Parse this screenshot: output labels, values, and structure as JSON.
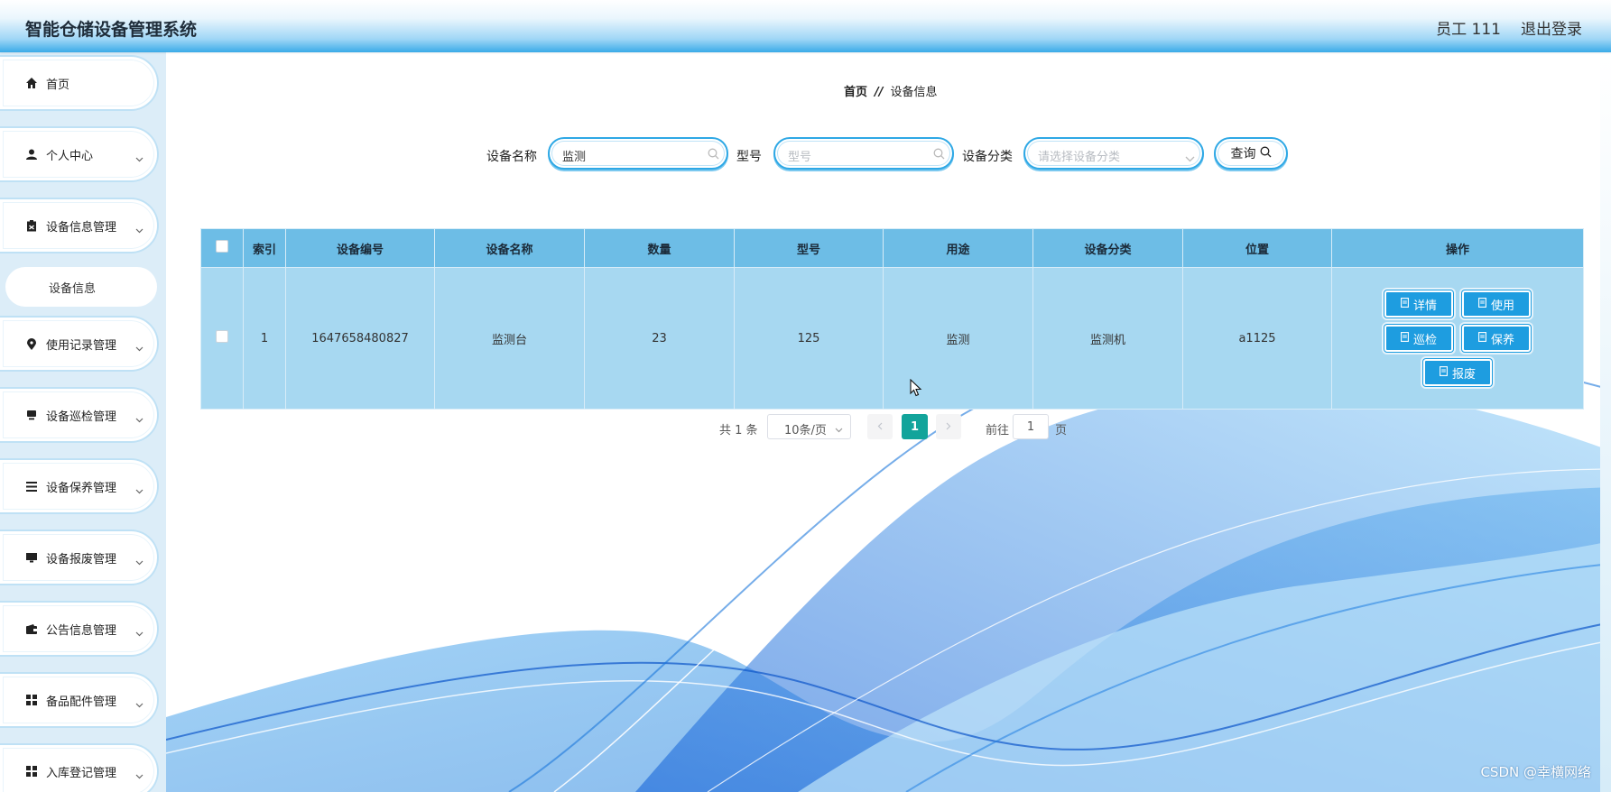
{
  "header": {
    "title": "智能仓储设备管理系统",
    "user": "员工 111",
    "logout": "退出登录"
  },
  "sidebar": {
    "items": [
      {
        "label": "首页",
        "icon": "home-icon"
      },
      {
        "label": "个人中心",
        "icon": "user-icon"
      },
      {
        "label": "设备信息管理",
        "icon": "clipboard-icon"
      },
      {
        "label": "使用记录管理",
        "icon": "location-pin-icon"
      },
      {
        "label": "设备巡检管理",
        "icon": "monitor-icon"
      },
      {
        "label": "设备保养管理",
        "icon": "list-icon"
      },
      {
        "label": "设备报废管理",
        "icon": "desktop-icon"
      },
      {
        "label": "公告信息管理",
        "icon": "wallet-icon"
      },
      {
        "label": "备品配件管理",
        "icon": "grid-icon"
      },
      {
        "label": "入库登记管理",
        "icon": "grid-icon"
      }
    ],
    "active_sub": "设备信息"
  },
  "breadcrumb": {
    "home": "首页",
    "separator": "//",
    "current": "设备信息"
  },
  "search": {
    "name_label": "设备名称",
    "name_value": "监测",
    "model_label": "型号",
    "model_placeholder": "型号",
    "category_label": "设备分类",
    "category_placeholder": "请选择设备分类",
    "query_label": "查询"
  },
  "table": {
    "headers": [
      "索引",
      "设备编号",
      "设备名称",
      "数量",
      "型号",
      "用途",
      "设备分类",
      "位置",
      "操作"
    ],
    "rows": [
      {
        "index": "1",
        "code": "1647658480827",
        "name": "监测台",
        "qty": "23",
        "model": "125",
        "usage": "监测",
        "category": "监测机",
        "location": "a1125"
      }
    ],
    "actions": [
      "详情",
      "使用",
      "巡检",
      "保养",
      "报废"
    ]
  },
  "pagination": {
    "total": "共 1 条",
    "page_size": "10条/页",
    "current": "1",
    "goto_label": "前往",
    "goto_value": "1",
    "page_suffix": "页"
  },
  "watermark": "CSDN @幸横网络",
  "colors": {
    "accent": "#2ea8e5",
    "header_cell": "#6dbde6",
    "row_cell": "#a7d8f1",
    "button": "#1e9de0",
    "page_active": "#12a49b"
  }
}
